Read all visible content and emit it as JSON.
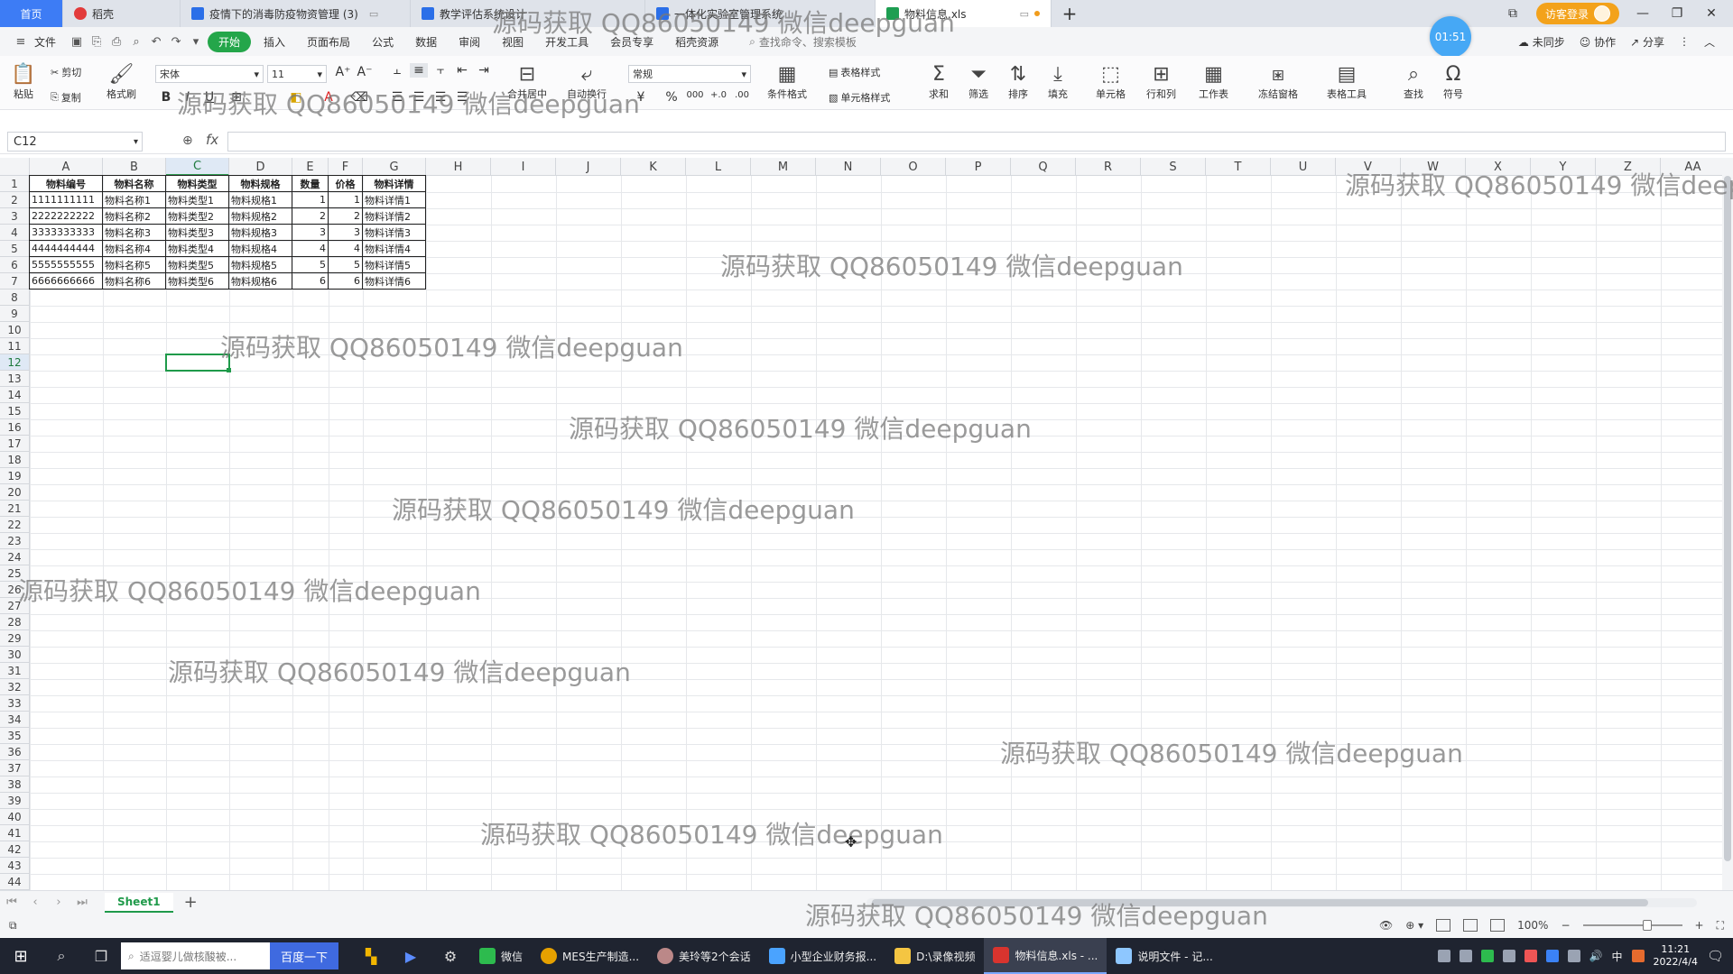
{
  "tabs": {
    "home": "首页",
    "docer": "稻壳",
    "doc1": "疫情下的消毒防疫物资管理 (3)",
    "doc2": "教学评估系统设计",
    "doc3": "一体化实验室管理系统",
    "doc4": "物料信息.xls",
    "login": "访客登录"
  },
  "menu": {
    "file": "文件",
    "items": [
      "开始",
      "插入",
      "页面布局",
      "公式",
      "数据",
      "审阅",
      "视图",
      "开发工具",
      "会员专享",
      "稻壳资源"
    ],
    "search": "查找命令、搜索模板",
    "sync": "未同步",
    "collab": "协作",
    "share": "分享",
    "timer": "01:51"
  },
  "ribbon": {
    "paste": "粘贴",
    "cut": "剪切",
    "copy": "复制",
    "format_painter": "格式刷",
    "font_name": "宋体",
    "font_size": "11",
    "merge": "合并居中",
    "wrap": "自动换行",
    "number_format": "常规",
    "cond_format": "条件格式",
    "table_style": "表格样式",
    "cell_style": "单元格样式",
    "sum": "求和",
    "filter": "筛选",
    "sort": "排序",
    "fill": "填充",
    "cell": "单元格",
    "rowcol": "行和列",
    "worksheet": "工作表",
    "freeze": "冻结窗格",
    "table_tools": "表格工具",
    "find": "查找",
    "symbol": "符号"
  },
  "formula_bar": {
    "name_box": "C12",
    "fx": "fx",
    "value": ""
  },
  "grid": {
    "columns": [
      "A",
      "B",
      "C",
      "D",
      "E",
      "F",
      "G",
      "H",
      "I",
      "J",
      "K",
      "L",
      "M",
      "N",
      "O",
      "P",
      "Q",
      "R",
      "S",
      "T",
      "U",
      "V",
      "W",
      "X",
      "Y",
      "Z",
      "AA"
    ],
    "row_count": 44,
    "selected_col": "C",
    "selected_row": 12,
    "header_row": [
      "物料编号",
      "物料名称",
      "物料类型",
      "物料规格",
      "数量",
      "价格",
      "物料详情"
    ],
    "rows": [
      [
        "1111111111",
        "物料名称1",
        "物料类型1",
        "物料规格1",
        "1",
        "1",
        "物料详情1"
      ],
      [
        "2222222222",
        "物料名称2",
        "物料类型2",
        "物料规格2",
        "2",
        "2",
        "物料详情2"
      ],
      [
        "3333333333",
        "物料名称3",
        "物料类型3",
        "物料规格3",
        "3",
        "3",
        "物料详情3"
      ],
      [
        "4444444444",
        "物料名称4",
        "物料类型4",
        "物料规格4",
        "4",
        "4",
        "物料详情4"
      ],
      [
        "5555555555",
        "物料名称5",
        "物料类型5",
        "物料规格5",
        "5",
        "5",
        "物料详情5"
      ],
      [
        "6666666666",
        "物料名称6",
        "物料类型6",
        "物料规格6",
        "6",
        "6",
        "物料详情6"
      ]
    ]
  },
  "sheets": {
    "active": "Sheet1"
  },
  "status": {
    "zoom": "100%"
  },
  "taskbar": {
    "search_placeholder": "适逗婴儿做核酸被...",
    "search_button": "百度一下",
    "apps": [
      "微信",
      "MES生产制造...",
      "美玲等2个会话",
      "小型企业财务报...",
      "D:\\录像视频",
      "物料信息.xls - ...",
      "说明文件 - 记..."
    ],
    "ime": "中",
    "time": "11:21",
    "date": "2022/4/4"
  },
  "watermark": "源码获取 QQ86050149 微信deepguan"
}
